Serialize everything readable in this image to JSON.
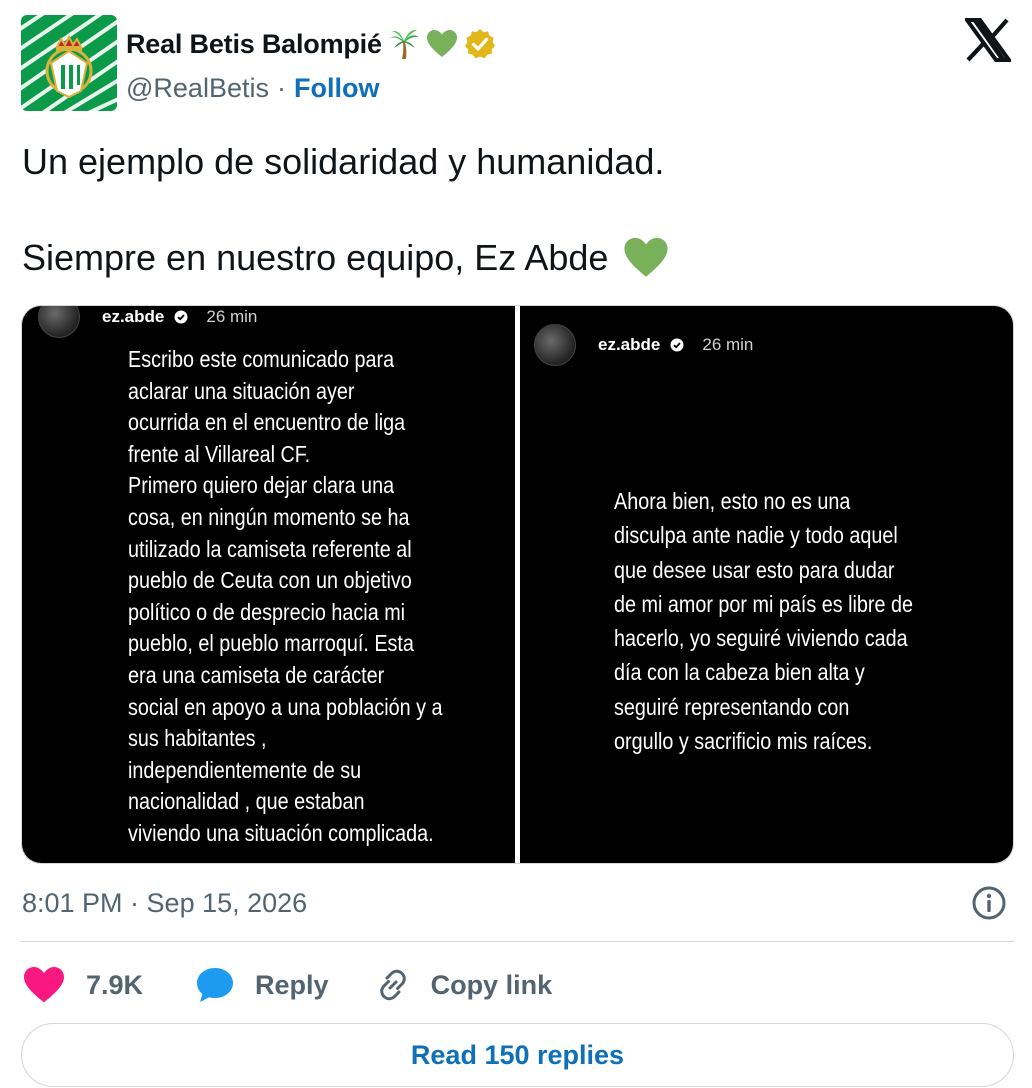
{
  "author": {
    "display_name": "Real Betis Balompié",
    "handle": "@RealBetis",
    "separator": "·",
    "follow_label": "Follow",
    "badges": [
      "palm-tree-emoji",
      "green-heart-emoji",
      "verified-badge-gold"
    ]
  },
  "tweet": {
    "lines": [
      "Un ejemplo de solidaridad y humanidad.",
      "Siempre en nuestro equipo, Ez Abde"
    ],
    "trailing_emoji": "green-heart-emoji"
  },
  "media": {
    "stories": [
      {
        "username": "ez.abde",
        "time": "26 min",
        "text": "Escribo este comunicado para\naclarar una situación ayer\nocurrida en el encuentro de liga\nfrente al Villareal CF.\nPrimero quiero dejar clara una\ncosa, en ningún momento se ha\nutilizado la camiseta referente al\npueblo de Ceuta con un objetivo\npolítico o de desprecio hacia mi\npueblo, el pueblo marroquí. Esta\nera una camiseta de carácter\nsocial en apoyo a una población y a\nsus habitantes ,\nindependientemente de su\nnacionalidad , que estaban\nviviendo una situación complicada."
      },
      {
        "username": "ez.abde",
        "time": "26 min",
        "text": "Ahora bien, esto no es una\ndisculpa ante nadie y todo aquel\nque desee usar esto para dudar\nde mi amor por mi país es libre de\nhacerlo, yo seguiré viviendo cada\ndía con la cabeza bien alta y\nseguiré representando con\norgullo y sacrificio mis raíces."
      }
    ]
  },
  "meta": {
    "timestamp": "8:01 PM · Sep 15, 2026"
  },
  "actions": {
    "likes_count": "7.9K",
    "reply_label": "Reply",
    "copy_link_label": "Copy link"
  },
  "footer": {
    "read_replies_label": "Read 150 replies"
  },
  "colors": {
    "link_blue": "#0f6fb8",
    "like_pink": "#f91880",
    "reply_blue": "#1d9bf0",
    "betis_green": "#0b9a4a",
    "muted": "#536471",
    "border": "#cfd9de"
  }
}
